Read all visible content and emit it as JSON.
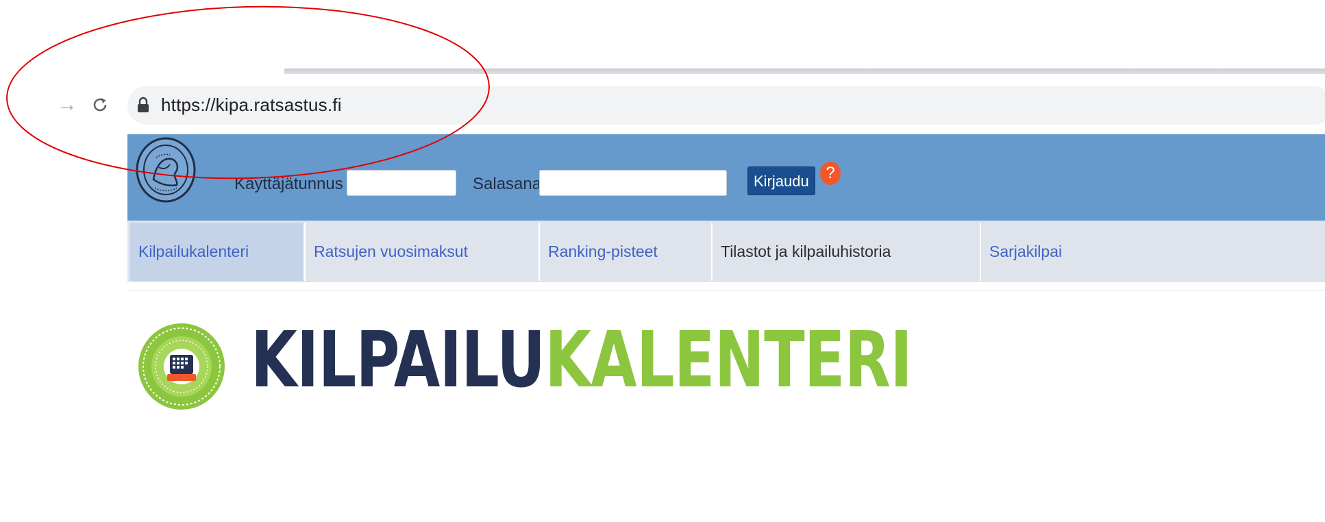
{
  "browser": {
    "url": "https://kipa.ratsastus.fi",
    "forward_icon": "forward-arrow-icon",
    "reload_icon": "reload-icon",
    "lock_icon": "lock-icon"
  },
  "header": {
    "username_label": "Käyttäjätunnus",
    "password_label": "Salasana",
    "username_value": "",
    "password_value": "",
    "login_label": "Kirjaudu",
    "help_label": "?",
    "accent_color": "#6699cc",
    "button_color": "#1a4f8f",
    "help_color": "#f0582a"
  },
  "nav": {
    "items": [
      {
        "label": "Kilpailukalenteri",
        "active": true
      },
      {
        "label": "Ratsujen vuosimaksut",
        "active": false
      },
      {
        "label": "Ranking-pisteet",
        "active": false
      },
      {
        "label": "Tilastot ja kilpailuhistoria",
        "active": false
      },
      {
        "label": "Sarjakilpai",
        "active": false
      }
    ]
  },
  "banner": {
    "title_part1": "KILPAILU",
    "title_part2": "KALENTERI",
    "color_part1": "#243152",
    "color_part2": "#8cc63e"
  },
  "annotation": {
    "shape": "ellipse",
    "color": "#e00000"
  }
}
